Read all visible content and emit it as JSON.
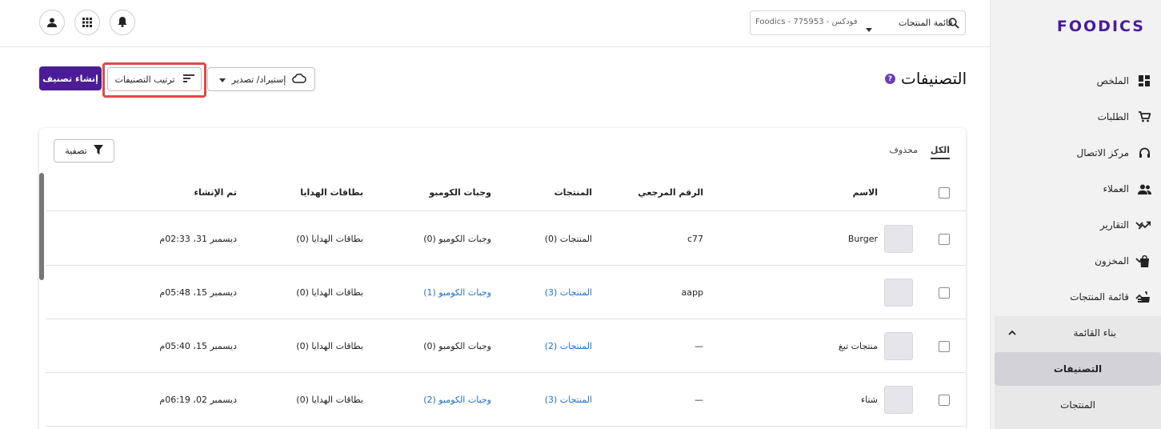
{
  "sidebar": {
    "logo": "FOODICS",
    "items": [
      {
        "label": "الملخص",
        "icon": "dashboard-icon"
      },
      {
        "label": "الطلبات",
        "icon": "cart-icon"
      },
      {
        "label": "مركز الاتصال",
        "icon": "headset-icon"
      },
      {
        "label": "العملاء",
        "icon": "people-icon"
      },
      {
        "label": "التقارير",
        "icon": "trending-icon"
      },
      {
        "label": "المخزون",
        "icon": "bag-icon"
      },
      {
        "label": "قائمة المنتجات",
        "icon": "menu-food-icon"
      }
    ],
    "sub_group": "بناء القائمة",
    "sub_items": [
      "التصنيفات",
      "المنتجات"
    ]
  },
  "topbar": {
    "menu_label": "قائمة المنتجات",
    "branch": "Foodics - فودكس - 775953"
  },
  "header": {
    "title": "التصنيفات",
    "create_label": "إنشاء تصنيف",
    "sort_label": "ترتيب التصنيفات",
    "import_label": "إستيراد/ تصدير"
  },
  "card": {
    "tab_all": "الكل",
    "tab_deleted": "محذوف",
    "filter_label": "تصفية",
    "columns": {
      "name": "الاسم",
      "ref": "الرقم المرجعي",
      "products": "المنتجات",
      "combos": "وجبات الكومبو",
      "gift_cards": "بطاقات الهدايا",
      "created": "تم الإنشاء"
    },
    "rows": [
      {
        "name": "Burger",
        "ref": "c77",
        "products": "المنتجات (0)",
        "products_link": false,
        "combos": "وجبات الكومبو (0)",
        "combos_link": false,
        "gift_cards": "بطاقات الهدايا (0)",
        "created": "ديسمبر 31، 02:33م"
      },
      {
        "name": "",
        "ref": "aapp",
        "products": "المنتجات (3)",
        "products_link": true,
        "combos": "وجبات الكومبو (1)",
        "combos_link": true,
        "gift_cards": "بطاقات الهدايا (0)",
        "created": "ديسمبر 15، 05:48م"
      },
      {
        "name": "منتجات تبغ",
        "ref": "—",
        "products": "المنتجات (2)",
        "products_link": true,
        "combos": "وجبات الكومبو (0)",
        "combos_link": false,
        "gift_cards": "بطاقات الهدايا (0)",
        "created": "ديسمبر 15، 05:40م"
      },
      {
        "name": "شتاء",
        "ref": "—",
        "products": "المنتجات (3)",
        "products_link": true,
        "combos": "وجبات الكومبو (2)",
        "combos_link": true,
        "gift_cards": "بطاقات الهدايا (0)",
        "created": "ديسمبر 02، 06:19م"
      }
    ]
  },
  "colors": {
    "brand": "#4a1d96",
    "link": "#1f6fd1",
    "highlight": "#e04848"
  }
}
